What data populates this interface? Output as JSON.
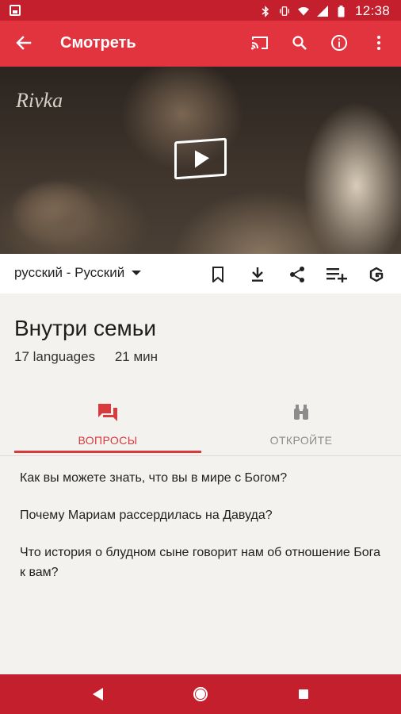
{
  "status_bar": {
    "time": "12:38",
    "icons": [
      "image-notification-icon",
      "bluetooth-icon",
      "vibrate-icon",
      "wifi-icon",
      "signal-icon",
      "battery-icon"
    ]
  },
  "app_bar": {
    "title": "Смотреть",
    "icons": [
      "back-arrow-icon",
      "cast-icon",
      "search-icon",
      "info-icon",
      "more-vert-icon"
    ]
  },
  "video": {
    "watermark": "Rivka"
  },
  "language": {
    "selected": "русский - Русский",
    "actions": [
      "bookmark-icon",
      "download-icon",
      "share-icon",
      "playlist-add-icon",
      "brand-g-icon"
    ]
  },
  "item": {
    "title": "Внутри семьи",
    "languages_count": "17 languages",
    "duration": "21 мин"
  },
  "tabs": [
    {
      "label": "ВОПРОСЫ",
      "icon": "forum-icon",
      "active": true
    },
    {
      "label": "ОТКРОЙТЕ",
      "icon": "binoculars-icon",
      "active": false
    }
  ],
  "questions": [
    "Как вы можете знать, что вы в мире с Богом?",
    "Почему Мариам рассердилась на Давуда?",
    "Что история о блудном сыне говорит нам об отношение Бога к вам?"
  ],
  "colors": {
    "status_bar": "#c41f2c",
    "app_bar": "#e1343f",
    "accent": "#d93a3d",
    "background": "#f4f2ee"
  }
}
